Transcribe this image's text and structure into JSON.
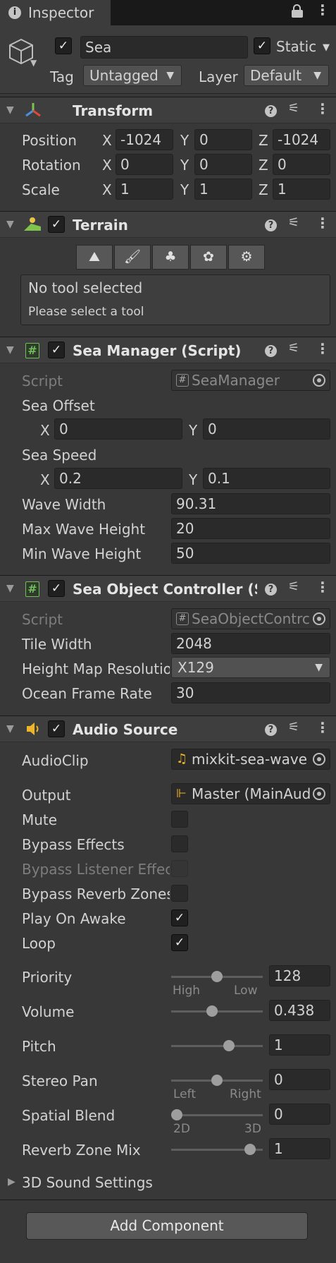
{
  "tab": {
    "title": "Inspector"
  },
  "header": {
    "object_name": "Sea",
    "static_label": "Static",
    "tag_label": "Tag",
    "tag_value": "Untagged",
    "layer_label": "Layer",
    "layer_value": "Default"
  },
  "transform": {
    "title": "Transform",
    "rows": [
      {
        "label": "Position",
        "x": "-1024",
        "y": "0",
        "z": "-1024"
      },
      {
        "label": "Rotation",
        "x": "0",
        "y": "0",
        "z": "0"
      },
      {
        "label": "Scale",
        "x": "1",
        "y": "1",
        "z": "1"
      }
    ],
    "axis": {
      "x": "X",
      "y": "Y",
      "z": "Z"
    }
  },
  "terrain": {
    "title": "Terrain",
    "status": "No tool selected",
    "hint": "Please select a tool"
  },
  "sea_manager": {
    "title": "Sea Manager (Script)",
    "script_label": "Script",
    "script_value": "SeaManager",
    "offset_label": "Sea Offset",
    "offset_x": "0",
    "offset_y": "0",
    "speed_label": "Sea Speed",
    "speed_x": "0.2",
    "speed_y": "0.1",
    "wave_width_label": "Wave Width",
    "wave_width": "90.31",
    "max_wave_label": "Max Wave Height",
    "max_wave": "20",
    "min_wave_label": "Min Wave Height",
    "min_wave": "50"
  },
  "sea_object": {
    "title": "Sea Object Controller (Sc",
    "script_label": "Script",
    "script_value": "SeaObjectContrc",
    "tile_width_label": "Tile Width",
    "tile_width": "2048",
    "heightmap_label": "Height Map Resolutio",
    "heightmap_value": "X129",
    "frame_rate_label": "Ocean Frame Rate",
    "frame_rate": "30"
  },
  "audio": {
    "title": "Audio Source",
    "clip_label": "AudioClip",
    "clip_value": "mixkit-sea-wave",
    "output_label": "Output",
    "output_value": "Master (MainAud",
    "mute_label": "Mute",
    "bypass_effects_label": "Bypass Effects",
    "bypass_listener_label": "Bypass Listener Effec",
    "bypass_reverb_label": "Bypass Reverb Zones",
    "play_on_awake_label": "Play On Awake",
    "loop_label": "Loop",
    "priority_label": "Priority",
    "priority": "128",
    "priority_low_word": "High",
    "priority_high_word": "Low",
    "priority_fraction": 0.5,
    "volume_label": "Volume",
    "volume": "0.438",
    "volume_fraction": 0.438,
    "pitch_label": "Pitch",
    "pitch": "1",
    "pitch_fraction": 0.65,
    "stereo_label": "Stereo Pan",
    "stereo": "0",
    "stereo_left": "Left",
    "stereo_right": "Right",
    "stereo_fraction": 0.5,
    "spatial_label": "Spatial Blend",
    "spatial": "0",
    "spatial_2d": "2D",
    "spatial_3d": "3D",
    "spatial_fraction": 0.0,
    "reverb_mix_label": "Reverb Zone Mix",
    "reverb_mix": "1",
    "reverb_mix_fraction": 0.91,
    "sound3d_label": "3D Sound Settings"
  },
  "footer": {
    "add_component": "Add Component"
  },
  "icons": [
    "info-icon",
    "lock-icon",
    "kebab-icon",
    "cube-icon",
    "transform-icon",
    "terrain-icon",
    "script-icon",
    "audio-icon",
    "help-icon",
    "presets-icon",
    "music-note-icon",
    "mixer-icon",
    "object-picker-icon",
    "gear-icon",
    "brush-icon",
    "tree-icon",
    "raise-terrain-icon",
    "details-icon"
  ]
}
